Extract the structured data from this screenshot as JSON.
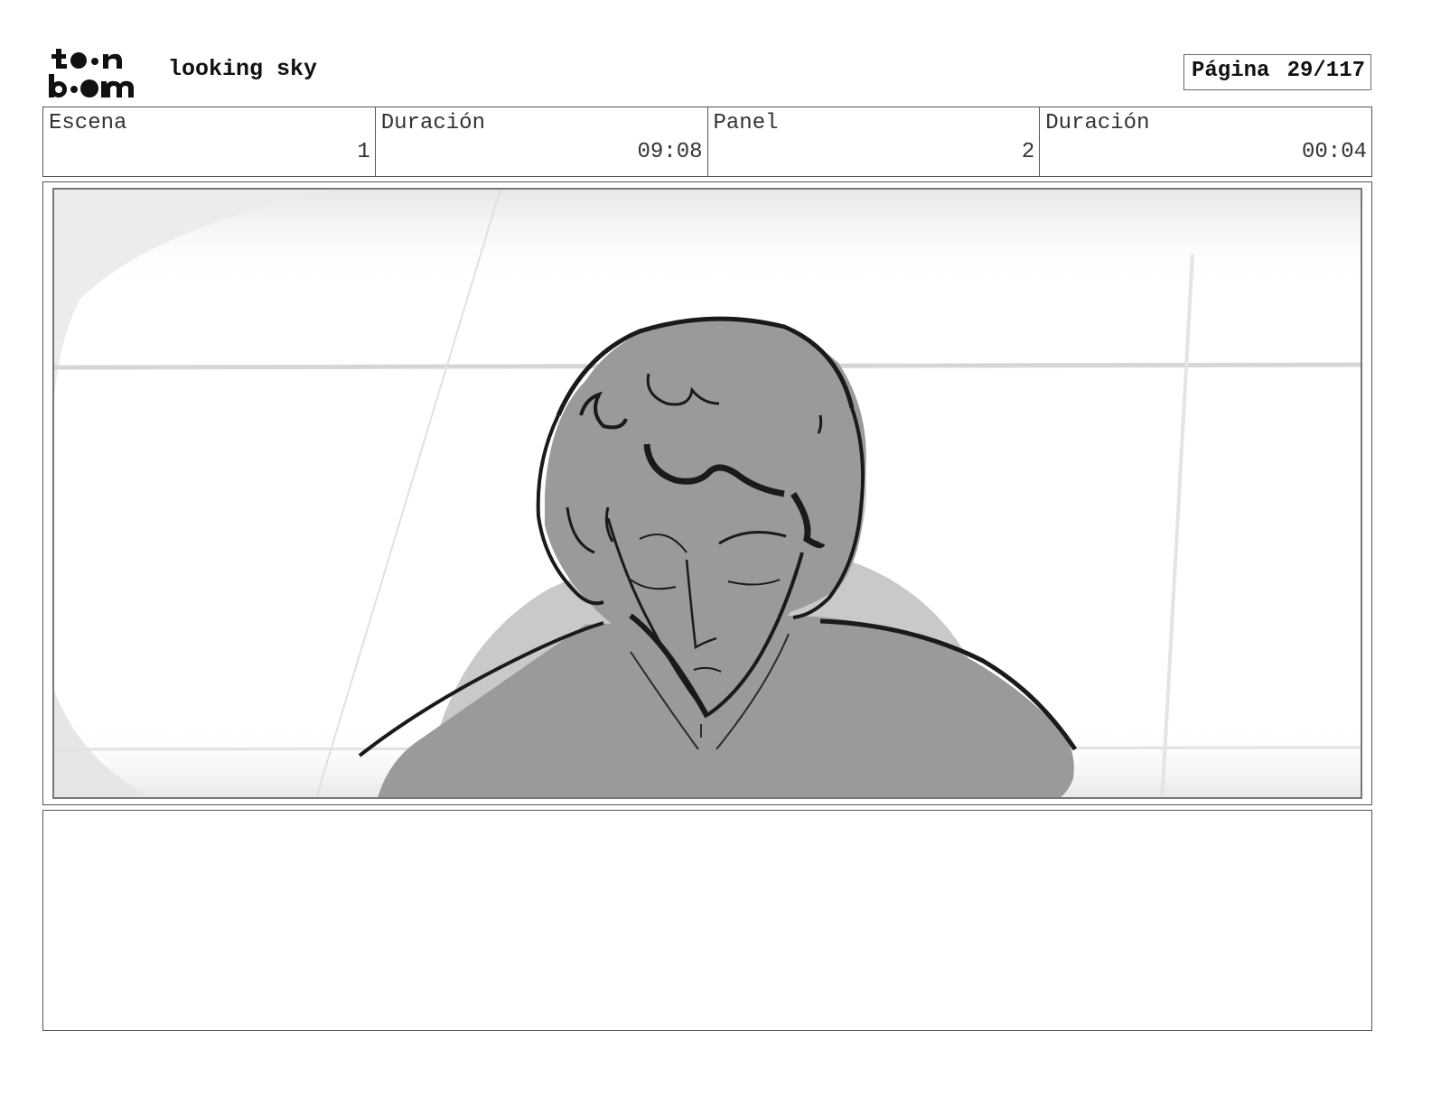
{
  "header": {
    "logo_top": "toon",
    "logo_bottom": "boom",
    "project_title": "looking sky",
    "page_label": "Página",
    "page_value": "29/117"
  },
  "info": {
    "scene_label": "Escena",
    "scene_value": "1",
    "scene_duration_label": "Duración",
    "scene_duration_value": "09:08",
    "panel_label": "Panel",
    "panel_value": "2",
    "panel_duration_label": "Duración",
    "panel_duration_value": "00:04"
  },
  "panel": {
    "description": ""
  },
  "colors": {
    "border": "#555555",
    "figure_fill": "#9a9a9a",
    "shadow_fill": "#c8c8c8",
    "ink": "#1a1a1a"
  }
}
